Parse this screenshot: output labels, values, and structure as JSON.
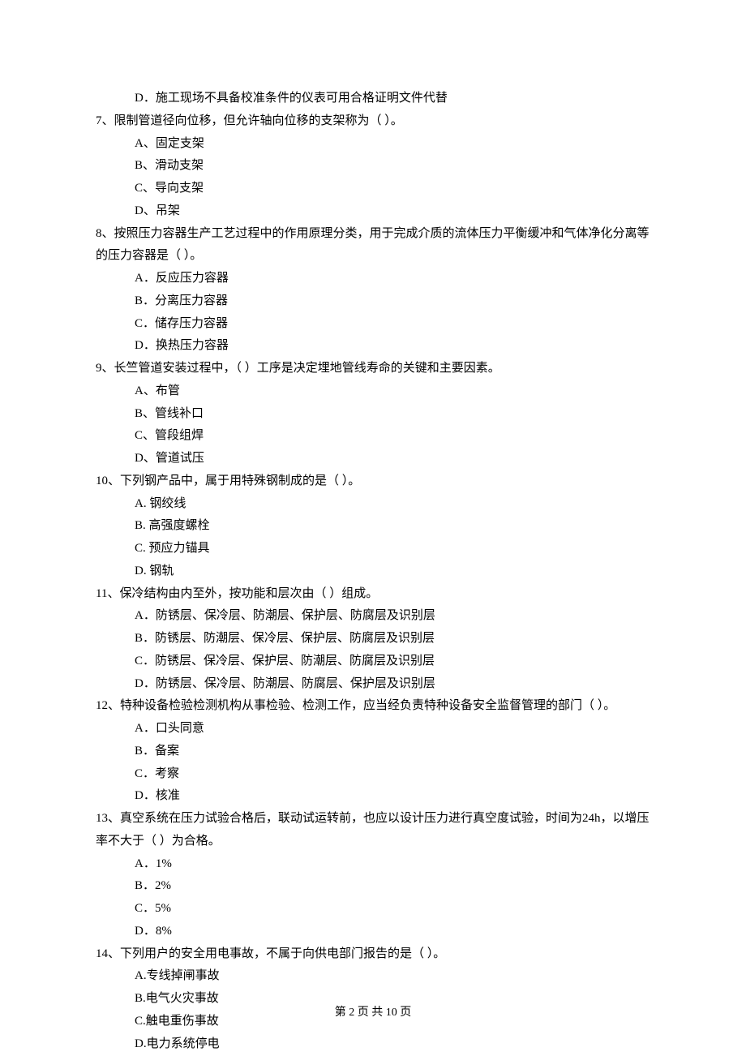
{
  "pretext_option": "D．施工现场不具备校准条件的仪表可用合格证明文件代替",
  "questions": [
    {
      "stem": "7、限制管道径向位移，但允许轴向位移的支架称为（    ）。",
      "options": [
        "A、固定支架",
        "B、滑动支架",
        "C、导向支架",
        "D、吊架"
      ]
    },
    {
      "stem": "8、按照压力容器生产工艺过程中的作用原理分类，用于完成介质的流体压力平衡缓冲和气体净化分离等的压力容器是（    ）。",
      "options": [
        "A．反应压力容器",
        "B．分离压力容器",
        "C．储存压力容器",
        "D．换热压力容器"
      ]
    },
    {
      "stem": "9、长竺管道安装过程中，（    ）工序是决定埋地管线寿命的关键和主要因素。",
      "options": [
        "A、布管",
        "B、管线补口",
        "C、管段组焊",
        "D、管道试压"
      ]
    },
    {
      "stem": "10、下列钢产品中，属于用特殊钢制成的是（    ）。",
      "options": [
        "A. 钢绞线",
        "B. 高强度螺栓",
        "C. 预应力锚具",
        "D. 钢轨"
      ]
    },
    {
      "stem": "11、保冷结构由内至外，按功能和层次由（    ）组成。",
      "options": [
        "A．防锈层、保冷层、防潮层、保护层、防腐层及识别层",
        "B．防锈层、防潮层、保冷层、保护层、防腐层及识别层",
        "C．防锈层、保冷层、保护层、防潮层、防腐层及识别层",
        "D．防锈层、保冷层、防潮层、防腐层、保护层及识别层"
      ]
    },
    {
      "stem": "12、特种设备检验检测机构从事检验、检测工作，应当经负责特种设备安全监督管理的部门（    ）。",
      "options": [
        "A．口头同意",
        "B．备案",
        "C．考察",
        "D．核准"
      ]
    },
    {
      "stem": "13、真空系统在压力试验合格后，联动试运转前，也应以设计压力进行真空度试验，时间为24h，以增压率不大于（    ）为合格。",
      "options": [
        "A．1%",
        "B．2%",
        "C．5%",
        "D．8%"
      ]
    },
    {
      "stem": "14、下列用户的安全用电事故，不属于向供电部门报告的是（    ）。",
      "options": [
        "A.专线掉闸事故",
        "B.电气火灾事故",
        "C.触电重伤事故",
        "D.电力系统停电"
      ]
    }
  ],
  "footer": "第 2 页 共 10 页"
}
